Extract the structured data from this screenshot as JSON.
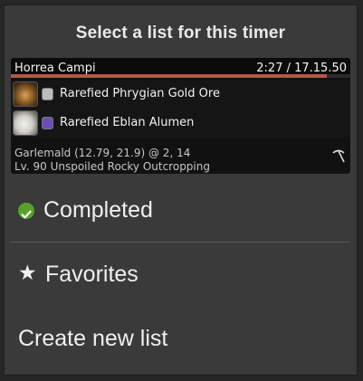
{
  "dialog": {
    "title": "Select a list for this timer"
  },
  "timer": {
    "location": "Horrea Campi",
    "clock": "2:27 / 17.15.50",
    "progress": 0.93,
    "items": [
      {
        "name": "Rarefied Phrygian Gold Ore",
        "icon": "ore-icon",
        "badge_color": "#bdbdbd"
      },
      {
        "name": "Rarefied Eblan Alumen",
        "icon": "alumen-icon",
        "badge_color": "#6a4fb8"
      }
    ],
    "coords": "Garlemald (12.79, 21.9) @ 2, 14",
    "node": "Lv. 90 Unspoiled Rocky Outcropping",
    "tool_icon": "pickaxe-icon"
  },
  "lists": {
    "completed": {
      "label": "Completed",
      "icon": "check-circle-icon",
      "icon_color": "#58a12b"
    },
    "favorites": {
      "label": "Favorites",
      "icon": "star-icon",
      "glyph": "★"
    },
    "create": {
      "label": "Create new list"
    }
  },
  "colors": {
    "background": "#262626",
    "panel": "#3a3a3a",
    "card": "#111111",
    "progress": "#b4574a"
  }
}
